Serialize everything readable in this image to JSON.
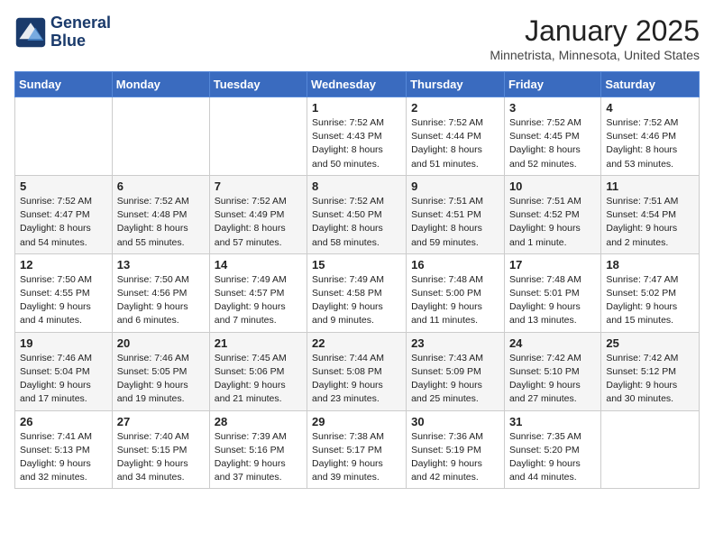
{
  "header": {
    "logo_line1": "General",
    "logo_line2": "Blue",
    "title": "January 2025",
    "subtitle": "Minnetrista, Minnesota, United States"
  },
  "weekdays": [
    "Sunday",
    "Monday",
    "Tuesday",
    "Wednesday",
    "Thursday",
    "Friday",
    "Saturday"
  ],
  "weeks": [
    [
      {
        "day": "",
        "info": ""
      },
      {
        "day": "",
        "info": ""
      },
      {
        "day": "",
        "info": ""
      },
      {
        "day": "1",
        "info": "Sunrise: 7:52 AM\nSunset: 4:43 PM\nDaylight: 8 hours\nand 50 minutes."
      },
      {
        "day": "2",
        "info": "Sunrise: 7:52 AM\nSunset: 4:44 PM\nDaylight: 8 hours\nand 51 minutes."
      },
      {
        "day": "3",
        "info": "Sunrise: 7:52 AM\nSunset: 4:45 PM\nDaylight: 8 hours\nand 52 minutes."
      },
      {
        "day": "4",
        "info": "Sunrise: 7:52 AM\nSunset: 4:46 PM\nDaylight: 8 hours\nand 53 minutes."
      }
    ],
    [
      {
        "day": "5",
        "info": "Sunrise: 7:52 AM\nSunset: 4:47 PM\nDaylight: 8 hours\nand 54 minutes."
      },
      {
        "day": "6",
        "info": "Sunrise: 7:52 AM\nSunset: 4:48 PM\nDaylight: 8 hours\nand 55 minutes."
      },
      {
        "day": "7",
        "info": "Sunrise: 7:52 AM\nSunset: 4:49 PM\nDaylight: 8 hours\nand 57 minutes."
      },
      {
        "day": "8",
        "info": "Sunrise: 7:52 AM\nSunset: 4:50 PM\nDaylight: 8 hours\nand 58 minutes."
      },
      {
        "day": "9",
        "info": "Sunrise: 7:51 AM\nSunset: 4:51 PM\nDaylight: 8 hours\nand 59 minutes."
      },
      {
        "day": "10",
        "info": "Sunrise: 7:51 AM\nSunset: 4:52 PM\nDaylight: 9 hours\nand 1 minute."
      },
      {
        "day": "11",
        "info": "Sunrise: 7:51 AM\nSunset: 4:54 PM\nDaylight: 9 hours\nand 2 minutes."
      }
    ],
    [
      {
        "day": "12",
        "info": "Sunrise: 7:50 AM\nSunset: 4:55 PM\nDaylight: 9 hours\nand 4 minutes."
      },
      {
        "day": "13",
        "info": "Sunrise: 7:50 AM\nSunset: 4:56 PM\nDaylight: 9 hours\nand 6 minutes."
      },
      {
        "day": "14",
        "info": "Sunrise: 7:49 AM\nSunset: 4:57 PM\nDaylight: 9 hours\nand 7 minutes."
      },
      {
        "day": "15",
        "info": "Sunrise: 7:49 AM\nSunset: 4:58 PM\nDaylight: 9 hours\nand 9 minutes."
      },
      {
        "day": "16",
        "info": "Sunrise: 7:48 AM\nSunset: 5:00 PM\nDaylight: 9 hours\nand 11 minutes."
      },
      {
        "day": "17",
        "info": "Sunrise: 7:48 AM\nSunset: 5:01 PM\nDaylight: 9 hours\nand 13 minutes."
      },
      {
        "day": "18",
        "info": "Sunrise: 7:47 AM\nSunset: 5:02 PM\nDaylight: 9 hours\nand 15 minutes."
      }
    ],
    [
      {
        "day": "19",
        "info": "Sunrise: 7:46 AM\nSunset: 5:04 PM\nDaylight: 9 hours\nand 17 minutes."
      },
      {
        "day": "20",
        "info": "Sunrise: 7:46 AM\nSunset: 5:05 PM\nDaylight: 9 hours\nand 19 minutes."
      },
      {
        "day": "21",
        "info": "Sunrise: 7:45 AM\nSunset: 5:06 PM\nDaylight: 9 hours\nand 21 minutes."
      },
      {
        "day": "22",
        "info": "Sunrise: 7:44 AM\nSunset: 5:08 PM\nDaylight: 9 hours\nand 23 minutes."
      },
      {
        "day": "23",
        "info": "Sunrise: 7:43 AM\nSunset: 5:09 PM\nDaylight: 9 hours\nand 25 minutes."
      },
      {
        "day": "24",
        "info": "Sunrise: 7:42 AM\nSunset: 5:10 PM\nDaylight: 9 hours\nand 27 minutes."
      },
      {
        "day": "25",
        "info": "Sunrise: 7:42 AM\nSunset: 5:12 PM\nDaylight: 9 hours\nand 30 minutes."
      }
    ],
    [
      {
        "day": "26",
        "info": "Sunrise: 7:41 AM\nSunset: 5:13 PM\nDaylight: 9 hours\nand 32 minutes."
      },
      {
        "day": "27",
        "info": "Sunrise: 7:40 AM\nSunset: 5:15 PM\nDaylight: 9 hours\nand 34 minutes."
      },
      {
        "day": "28",
        "info": "Sunrise: 7:39 AM\nSunset: 5:16 PM\nDaylight: 9 hours\nand 37 minutes."
      },
      {
        "day": "29",
        "info": "Sunrise: 7:38 AM\nSunset: 5:17 PM\nDaylight: 9 hours\nand 39 minutes."
      },
      {
        "day": "30",
        "info": "Sunrise: 7:36 AM\nSunset: 5:19 PM\nDaylight: 9 hours\nand 42 minutes."
      },
      {
        "day": "31",
        "info": "Sunrise: 7:35 AM\nSunset: 5:20 PM\nDaylight: 9 hours\nand 44 minutes."
      },
      {
        "day": "",
        "info": ""
      }
    ]
  ]
}
